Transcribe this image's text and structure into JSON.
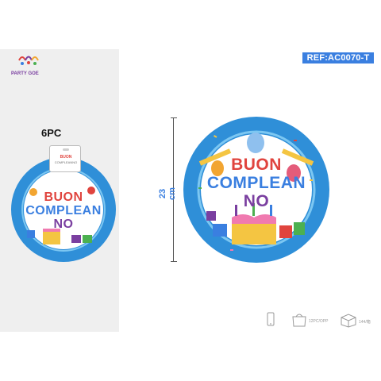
{
  "brand": {
    "logo_text": "PARTY GOE",
    "logo_icon": "party-goe-logo"
  },
  "product": {
    "ref": "REF:AC0070-T",
    "pack_count": "6PC",
    "dimension": "23 cm",
    "plate_text_line1": "BUON",
    "plate_text_line2": "COMPLEAN",
    "plate_text_line3": "NO",
    "pack_card_title": "BUON",
    "pack_card_subtitle": "COMPLEANNO"
  },
  "specs": [
    {
      "icon": "phone-icon",
      "label": ""
    },
    {
      "icon": "bag-icon",
      "label": "12PC/OPP"
    },
    {
      "icon": "box-icon",
      "label": "144/箱"
    }
  ],
  "colors": {
    "plate_blue": "#2f8fd8",
    "plate_white": "#ffffff",
    "ref_badge": "#3a7fe0",
    "left_panel": "#efefef"
  }
}
